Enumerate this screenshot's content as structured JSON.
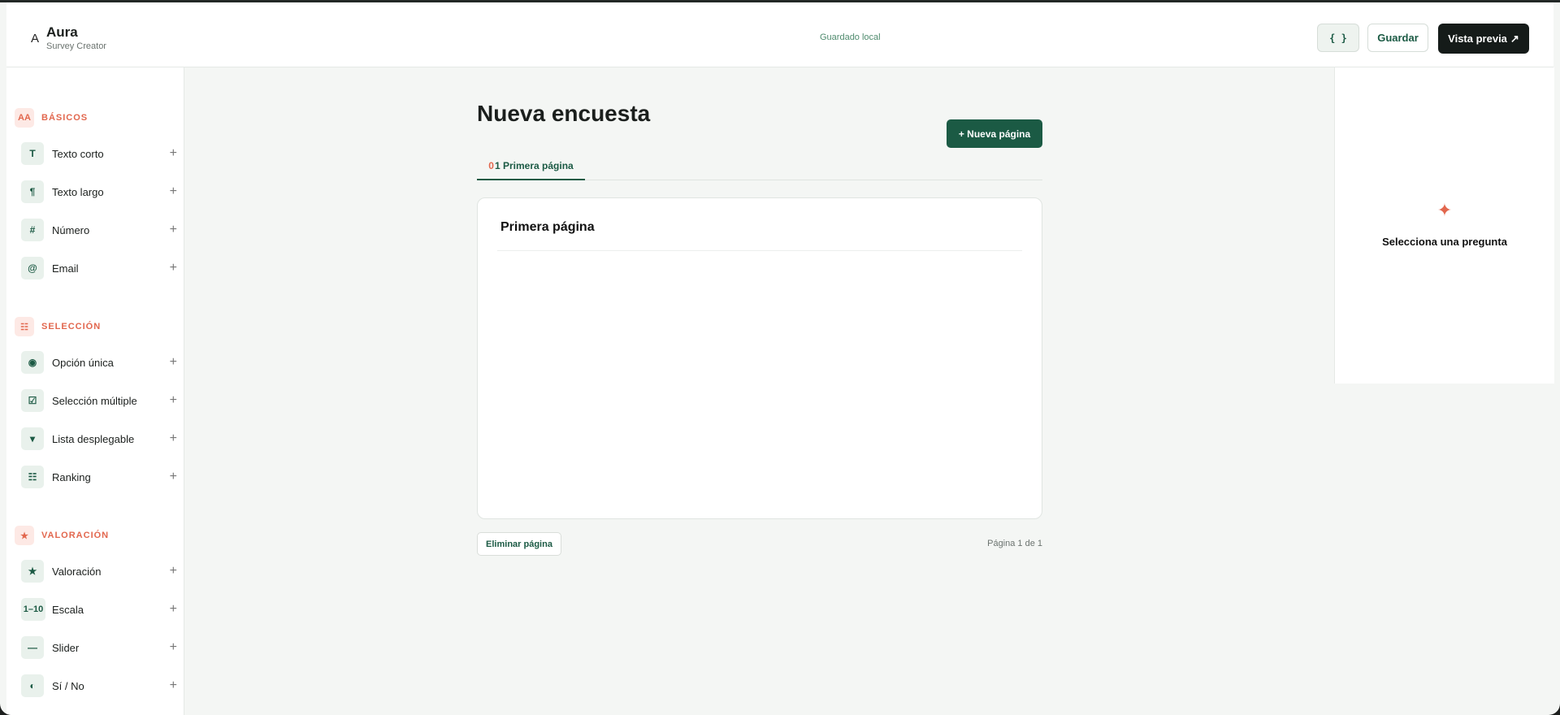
{
  "header": {
    "brand_mark": "A",
    "brand_name": "Aura",
    "brand_sub": "Survey Creator",
    "save_status": "Guardado local",
    "json_label": "{ }",
    "save_label": "Guardar",
    "preview_label": "Vista previa",
    "preview_icon": "↗"
  },
  "sidebar": {
    "sections": [
      {
        "badge": "AA",
        "title": "BÁSICOS",
        "items": [
          {
            "icon": "T",
            "label": "Texto corto"
          },
          {
            "icon": "¶",
            "label": "Texto largo"
          },
          {
            "icon": "#",
            "label": "Número"
          },
          {
            "icon": "@",
            "label": "Email"
          }
        ]
      },
      {
        "badge": "☷",
        "title": "SELECCIÓN",
        "items": [
          {
            "icon": "◉",
            "label": "Opción única"
          },
          {
            "icon": "☑",
            "label": "Selección múltiple"
          },
          {
            "icon": "▾",
            "label": "Lista desplegable"
          },
          {
            "icon": "☷",
            "label": "Ranking"
          }
        ]
      },
      {
        "badge": "★",
        "title": "VALORACIÓN",
        "items": [
          {
            "icon": "★",
            "label": "Valoración"
          },
          {
            "icon": "1–10",
            "label": "Escala"
          },
          {
            "icon": "—",
            "label": "Slider"
          },
          {
            "icon": "◐",
            "label": "Sí / No"
          }
        ]
      }
    ],
    "add_glyph": "+"
  },
  "main": {
    "title": "Nueva encuesta",
    "new_page_label": "+ Nueva página",
    "tabs": [
      {
        "num": "0",
        "label": "1 Primera página"
      }
    ],
    "page": {
      "title": "Primera página"
    },
    "delete_label": "Eliminar página",
    "page_counter": "Página 1 de 1"
  },
  "inspector": {
    "icon": "✦",
    "message": "Selecciona una pregunta"
  },
  "colors": {
    "accent": "#1b5a44",
    "highlight": "#e2674e",
    "dark_button": "#151b19"
  }
}
